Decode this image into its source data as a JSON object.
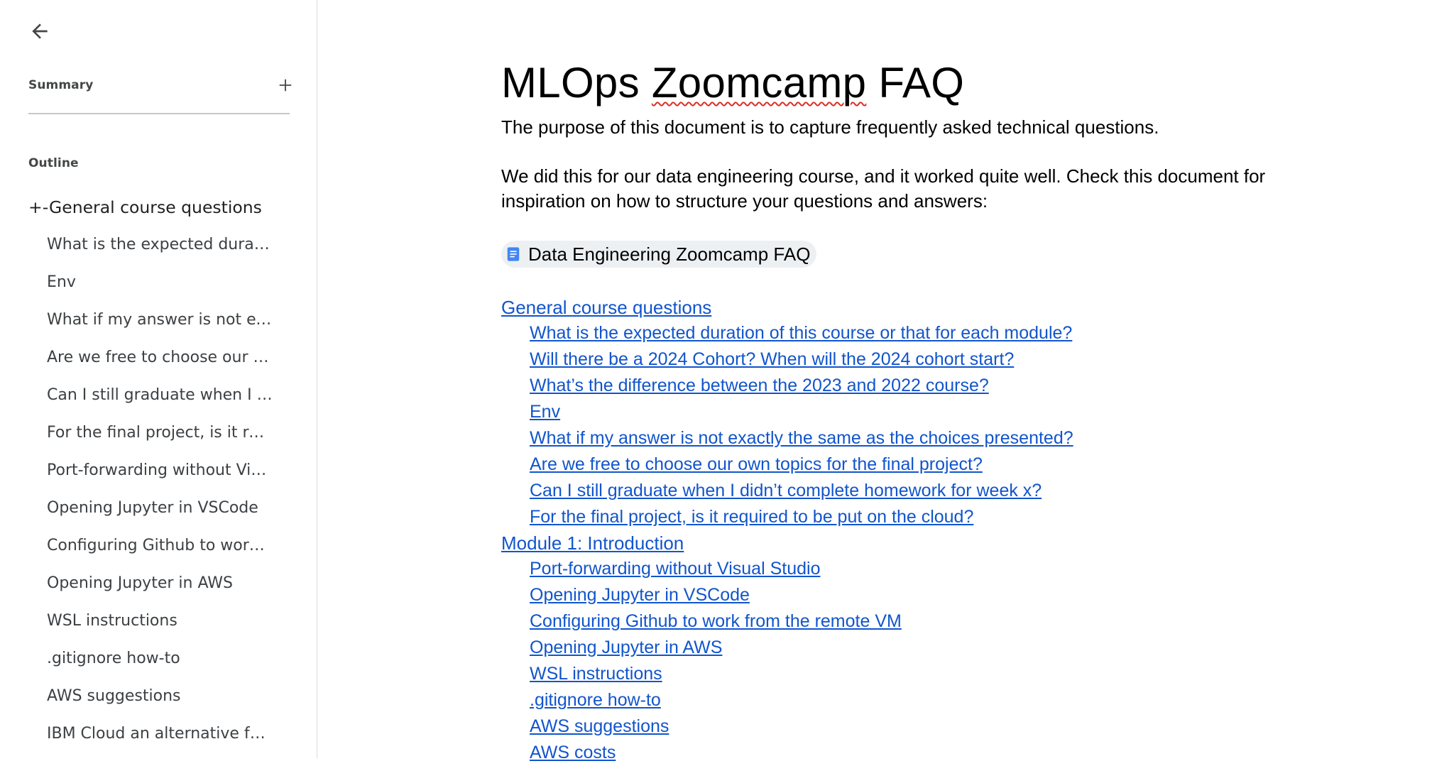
{
  "sidebar": {
    "summary_label": "Summary",
    "outline_label": "Outline",
    "outline_items": [
      {
        "label": "+-General course questions",
        "level": 1
      },
      {
        "label": "What is the expected duration of this course or that for each module?",
        "level": 2
      },
      {
        "label": "Env",
        "level": 2
      },
      {
        "label": "What if my answer is not exactly the same as the choices presented?",
        "level": 2
      },
      {
        "label": "Are we free to choose our own topics for the final project?",
        "level": 2
      },
      {
        "label": "Can I still graduate when I didn’t complete homework for week x?",
        "level": 2
      },
      {
        "label": "For the final project, is it required to be put on the cloud?",
        "level": 2
      },
      {
        "label": "Port-forwarding without Visual Studio",
        "level": 2
      },
      {
        "label": "Opening Jupyter in VSCode",
        "level": 2
      },
      {
        "label": "Configuring Github to work from the remote VM",
        "level": 2
      },
      {
        "label": "Opening Jupyter in AWS",
        "level": 2
      },
      {
        "label": "WSL instructions",
        "level": 2
      },
      {
        "label": ".gitignore how-to",
        "level": 2
      },
      {
        "label": "AWS suggestions",
        "level": 2
      },
      {
        "label": "IBM Cloud an alternative for AWS",
        "level": 2
      }
    ]
  },
  "doc": {
    "title_part1": "MLOps ",
    "title_part2": "Zoomcamp",
    "title_part3": " FAQ",
    "para1": "The purpose of this document is to capture frequently asked technical questions.",
    "para2": "We did this for our data engineering course, and it worked quite well. Check this document for inspiration on how to structure your questions and answers:",
    "chip_label": "Data Engineering Zoomcamp FAQ",
    "toc": [
      {
        "label": "General course questions",
        "level": 1
      },
      {
        "label": "What is the expected duration of this course or that for each module?",
        "level": 2
      },
      {
        "label": "Will there be a 2024 Cohort? When will the 2024 cohort start?",
        "level": 2
      },
      {
        "label": "What’s the difference between the 2023 and 2022 course?",
        "level": 2
      },
      {
        "label": "Env",
        "level": 2
      },
      {
        "label": "What if my answer is not exactly the same as the choices presented?",
        "level": 2
      },
      {
        "label": "Are we free to choose our own topics for the final project?",
        "level": 2
      },
      {
        "label": "Can I still graduate when I didn’t complete homework for week x?",
        "level": 2
      },
      {
        "label": "For the final project, is it required to be put on the cloud?",
        "level": 2
      },
      {
        "label": "Module 1: Introduction",
        "level": 1
      },
      {
        "label": "Port-forwarding without Visual Studio",
        "level": 2
      },
      {
        "label": "Opening Jupyter in VSCode",
        "level": 2
      },
      {
        "label": "Configuring Github to work from the remote VM",
        "level": 2
      },
      {
        "label": "Opening Jupyter in AWS",
        "level": 2
      },
      {
        "label": "WSL instructions",
        "level": 2
      },
      {
        "label": ".gitignore how-to",
        "level": 2
      },
      {
        "label": "AWS suggestions",
        "level": 2
      },
      {
        "label": "AWS costs",
        "level": 2
      }
    ]
  },
  "colors": {
    "link": "#1155cc",
    "chip_bg": "#edf0f3",
    "doc_icon": "#4285f4",
    "divider": "#dadce0"
  },
  "icons": {
    "back": "arrow-left-icon",
    "add": "plus-icon",
    "doc": "google-doc-icon"
  }
}
